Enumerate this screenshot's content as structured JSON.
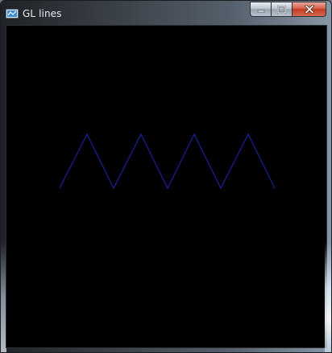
{
  "window": {
    "title": "GL lines",
    "icon": "opengl-app-icon"
  },
  "caption_buttons": {
    "minimize_icon": "minimize-icon",
    "maximize_icon": "maximize-icon",
    "close_icon": "close-icon"
  },
  "canvas": {
    "background_color": "#000000",
    "line_color": "#1a1f8f",
    "shape": "zigzag-polyline",
    "vertex_count": 9
  }
}
